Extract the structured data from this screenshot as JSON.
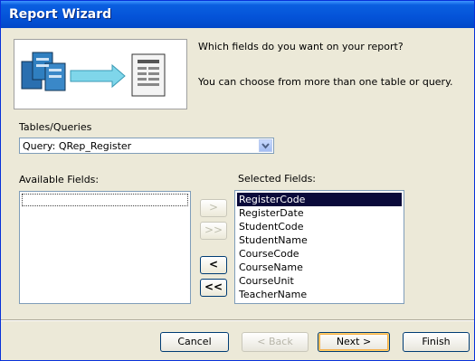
{
  "window": {
    "title": "Report Wizard"
  },
  "prompt": {
    "line1": "Which fields do you want on your report?",
    "line2": "You can choose from more than one table or query."
  },
  "tables_queries": {
    "label": "Tables/Queries",
    "selected": "Query: QRep_Register"
  },
  "available_fields": {
    "label": "Available Fields:",
    "items": []
  },
  "selected_fields": {
    "label": "Selected Fields:",
    "items": [
      "RegisterCode",
      "RegisterDate",
      "StudentCode",
      "StudentName",
      "CourseCode",
      "CourseName",
      "CourseUnit",
      "TeacherName"
    ],
    "active_index": 0
  },
  "move_buttons": {
    "add_one": ">",
    "add_all": ">>",
    "remove_one": "<",
    "remove_all": "<<"
  },
  "buttons": {
    "cancel": "Cancel",
    "back": "< Back",
    "next": "Next >",
    "finish": "Finish"
  },
  "colors": {
    "titlebar": "#0453d8",
    "selection": "#0a0a3a",
    "dialog_bg": "#ece9d8"
  }
}
